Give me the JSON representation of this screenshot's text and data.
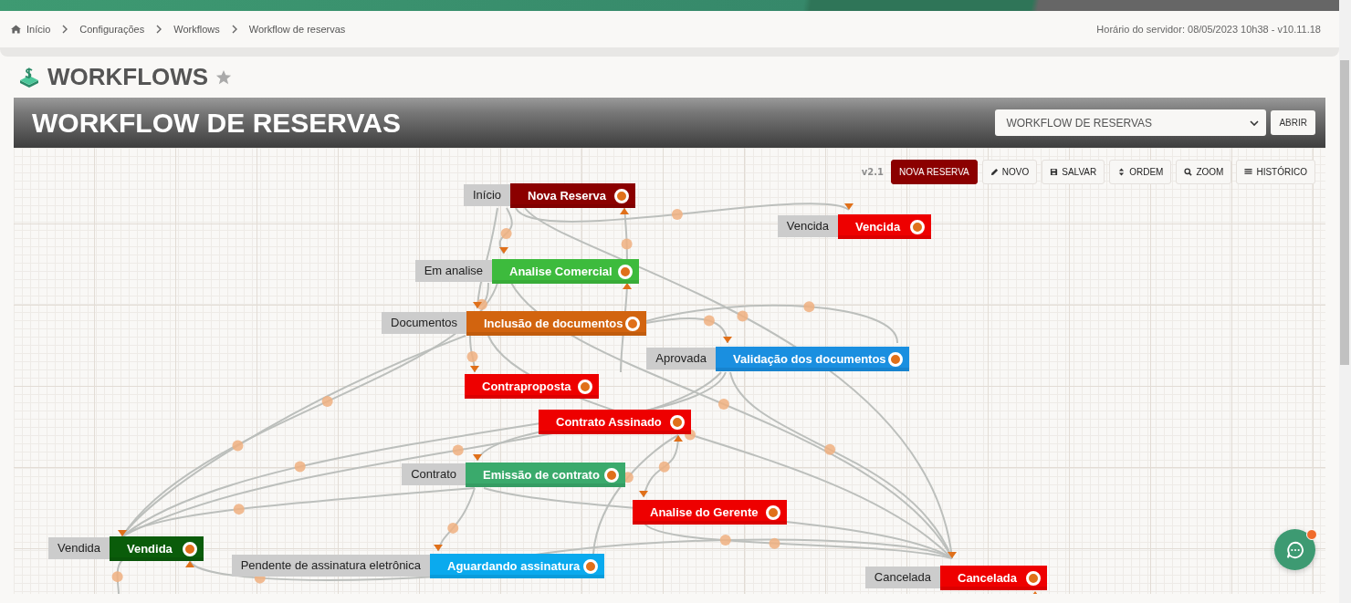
{
  "breadcrumb": [
    {
      "label": "Início",
      "kind": "home"
    },
    {
      "label": "Configurações",
      "kind": "link"
    },
    {
      "label": "Workflows",
      "kind": "link"
    },
    {
      "label": "Workflow de reservas",
      "kind": "current"
    }
  ],
  "server_time": "Horário do servidor: 08/05/2023 10h38 - v10.11.18",
  "page_title": "WORKFLOWS",
  "favorite": false,
  "panel": {
    "title": "WORKFLOW DE RESERVAS",
    "workflow_select": {
      "value": "WORKFLOW DE RESERVAS"
    },
    "open_button": "ABRIR"
  },
  "toolbar": {
    "version": "v2.1",
    "buttons": [
      {
        "label": "NOVA RESERVA",
        "kind": "primary"
      },
      {
        "label": "NOVO",
        "kind": "edit"
      },
      {
        "label": "SALVAR",
        "kind": "save"
      },
      {
        "label": "ORDEM",
        "kind": "sort"
      },
      {
        "label": "ZOOM",
        "kind": "zoom"
      },
      {
        "label": "HISTÓRICO",
        "kind": "list"
      }
    ]
  },
  "nodes": [
    {
      "tag": "Início",
      "title": "Nova Reserva",
      "color": "#8b0000"
    },
    {
      "tag": "Vencida",
      "title": "Vencida",
      "color": "#ee0000"
    },
    {
      "tag": "Em analise",
      "title": "Analise Comercial",
      "color": "#3dbb3d"
    },
    {
      "tag": "Documentos",
      "title": "Inclusão de documentos",
      "color": "#d2640f"
    },
    {
      "tag": "Aprovada",
      "title": "Validação dos documentos",
      "color": "#1a8fe0"
    },
    {
      "title": "Contraproposta",
      "color": "#ee0000"
    },
    {
      "title": "Contrato Assinado",
      "color": "#ee0000"
    },
    {
      "tag": "Contrato",
      "title": "Emissão de contrato",
      "color": "#3aaa6c"
    },
    {
      "title": "Analise do Gerente",
      "color": "#ee0000"
    },
    {
      "tag": "Vendida",
      "title": "Vendida",
      "color": "#0a5c0a"
    },
    {
      "tag": "Pendente de assinatura eletrônica",
      "title": "Aguardando assinatura",
      "color": "#0aaaee"
    },
    {
      "tag": "Cancelada",
      "title": "Cancelada",
      "color": "#ee0000"
    }
  ],
  "chat": {
    "notification": true
  }
}
